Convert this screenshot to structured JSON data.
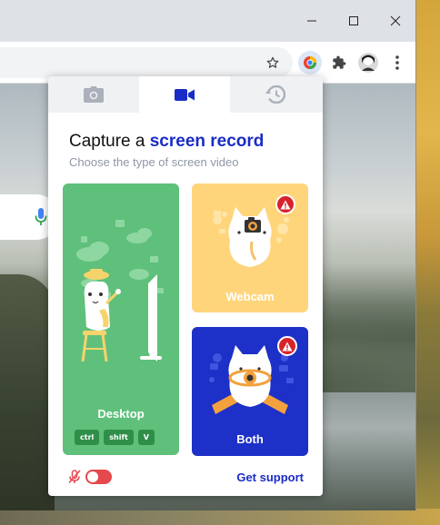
{
  "window": {
    "minimize_icon": "minimize-icon",
    "maximize_icon": "maximize-icon",
    "close_icon": "close-icon"
  },
  "toolbar": {
    "bookmark_icon": "star-icon",
    "extension_icon": "screen-recorder-icon",
    "extensions_icon": "puzzle-icon",
    "profile_icon": "avatar",
    "menu_icon": "more-vert-icon"
  },
  "popup": {
    "tabs": [
      {
        "icon": "camera-icon",
        "active": false
      },
      {
        "icon": "video-camera-icon",
        "active": true
      },
      {
        "icon": "history-icon",
        "active": false
      }
    ],
    "title_prefix": "Capture a",
    "title_accent": "screen record",
    "subtitle": "Choose the type of screen video",
    "cards": {
      "desktop": {
        "label": "Desktop",
        "shortcut": [
          "ctrl",
          "shift",
          "V"
        ]
      },
      "webcam": {
        "label": "Webcam",
        "warning": true
      },
      "both": {
        "label": "Both",
        "warning": true
      }
    },
    "footer": {
      "mic_icon": "mic-off-icon",
      "mic_enabled": false,
      "support_link": "Get support"
    }
  },
  "colors": {
    "accent": "#1a2cc7",
    "desktop_card": "#5fc07b",
    "webcam_card": "#ffd57c",
    "both_card": "#1d30c7",
    "warning": "#d8222a",
    "toggle_off": "#e5484d"
  }
}
